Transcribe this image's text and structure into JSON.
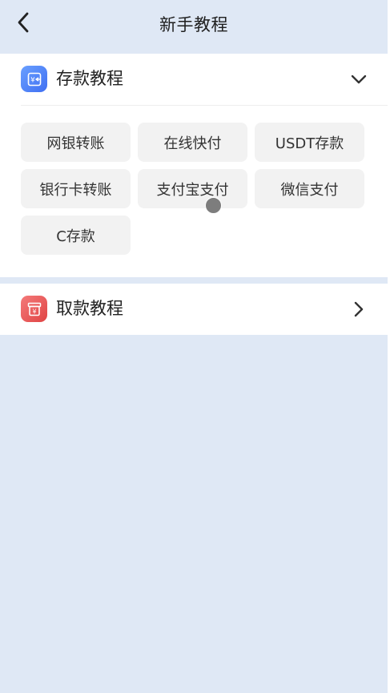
{
  "header": {
    "title": "新手教程",
    "back_icon": "chevron-left-icon"
  },
  "deposit_section": {
    "label": "存款教程",
    "icon": "deposit-icon",
    "icon_color": "#4f7ff5",
    "expanded": true,
    "toggle_icon": "chevron-down-icon",
    "options": [
      "网银转账",
      "在线快付",
      "USDT存款",
      "银行卡转账",
      "支付宝支付",
      "微信支付",
      "C存款"
    ]
  },
  "withdraw_section": {
    "label": "取款教程",
    "icon": "withdraw-icon",
    "icon_color": "#e45454",
    "expanded": false,
    "toggle_icon": "chevron-right-icon"
  },
  "colors": {
    "background": "#dfe8f5",
    "card": "#ffffff",
    "chip": "#f2f2f2"
  }
}
